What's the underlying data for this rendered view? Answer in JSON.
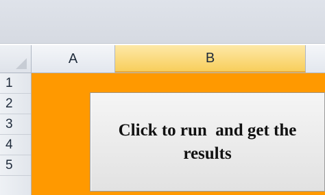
{
  "sheet": {
    "columns": [
      "A",
      "B"
    ],
    "selected_column": "B",
    "rows": [
      "1",
      "2",
      "3",
      "4",
      "5"
    ],
    "fill_color": "#ff9900"
  },
  "macro_button": {
    "label_line1": "Click to run  and get the",
    "label_line2": "results"
  }
}
